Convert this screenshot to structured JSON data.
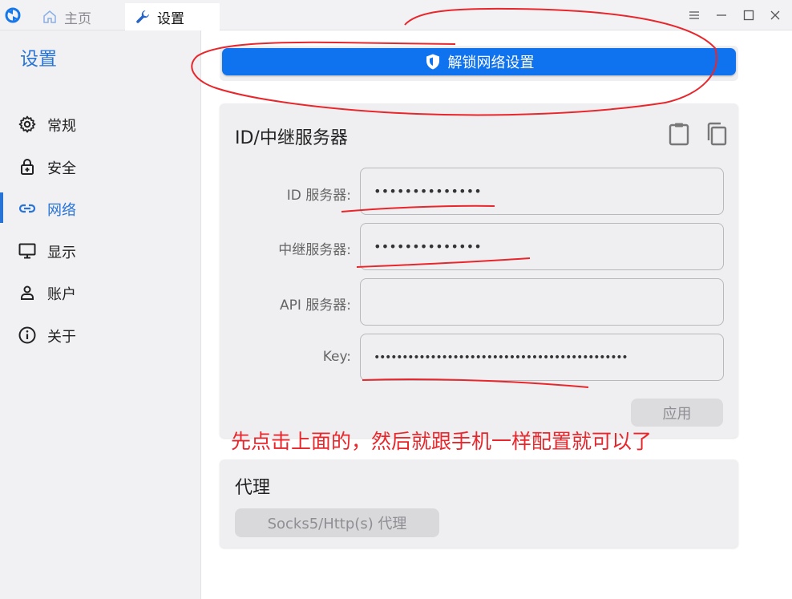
{
  "window": {
    "tabs": [
      {
        "label": "主页",
        "icon": "home-icon"
      },
      {
        "label": "设置",
        "icon": "wrench-icon"
      }
    ],
    "controls": [
      "menu-icon",
      "minimize-icon",
      "maximize-icon",
      "close-icon"
    ]
  },
  "sidebar": {
    "title": "设置",
    "items": [
      {
        "label": "常规",
        "icon": "gear-icon"
      },
      {
        "label": "安全",
        "icon": "lock-icon"
      },
      {
        "label": "网络",
        "icon": "link-icon",
        "active": true
      },
      {
        "label": "显示",
        "icon": "monitor-icon"
      },
      {
        "label": "账户",
        "icon": "person-icon"
      },
      {
        "label": "关于",
        "icon": "info-icon"
      }
    ]
  },
  "main": {
    "unlock_button": {
      "label": "解锁网络设置",
      "icon": "shield-icon"
    },
    "server_card": {
      "title": "ID/中继服务器",
      "fields": [
        {
          "label": "ID 服务器:",
          "value": "••••••••••••••"
        },
        {
          "label": "中继服务器:",
          "value": "••••••••••••••"
        },
        {
          "label": "API 服务器:",
          "value": ""
        },
        {
          "label": "Key:",
          "value": "•••••••••••••••••••••••••••••••••••••••••••••"
        }
      ],
      "apply_label": "应用"
    },
    "proxy_card": {
      "title": "代理",
      "button_label": "Socks5/Http(s) 代理"
    }
  },
  "annotation": {
    "text": "先点击上面的，然后就跟手机一样配置就可以了",
    "color": "#e8262b"
  },
  "colors": {
    "accent": "#2874d6",
    "primary_button": "#0f72ef"
  }
}
